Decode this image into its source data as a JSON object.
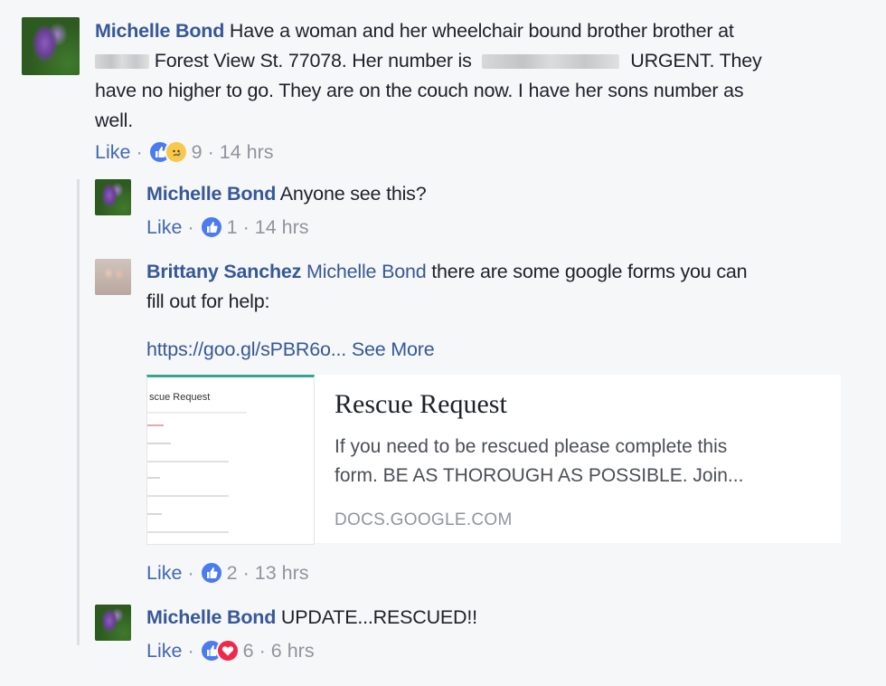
{
  "comments": {
    "main": {
      "author": "Michelle Bond",
      "line1": "Have a woman and her wheelchair bound brother brother at",
      "line2a": "Forest View St. 77078. Her number is",
      "line2b": "URGENT. They",
      "line3": "have no higher to go. They are on the couch now. I have her sons number as",
      "line4": "well.",
      "like_label": "Like",
      "reaction_count": "9",
      "time": "14 hrs"
    },
    "reply1": {
      "author": "Michelle Bond",
      "text": "Anyone see this?",
      "like_label": "Like",
      "reaction_count": "1",
      "time": "14 hrs"
    },
    "reply2": {
      "author": "Brittany Sanchez",
      "mention": "Michelle Bond",
      "line1": "there are some google forms you can",
      "line2": "fill out for help:",
      "link": "https://goo.gl/sPBR6o...",
      "see_more": "See More",
      "like_label": "Like",
      "reaction_count": "2",
      "time": "13 hrs"
    },
    "reply3": {
      "author": "Michelle Bond",
      "text": "UPDATE...RESCUED!!",
      "like_label": "Like",
      "reaction_count": "6",
      "time": "6 hrs"
    }
  },
  "link_preview": {
    "thumb_title": "scue Request",
    "title": "Rescue Request",
    "description_line1": "If you need to be rescued please complete this",
    "description_line2": "form. BE AS THOROUGH AS POSSIBLE. Join...",
    "domain": "DOCS.GOOGLE.COM"
  },
  "separator": "·",
  "icons": {
    "like": "like-reaction-icon",
    "sad": "sad-reaction-icon",
    "love": "love-reaction-icon"
  },
  "colors": {
    "name_link": "#365899",
    "meta_gray": "#90949c",
    "like_blue": "#4a7bf0",
    "love_red": "#f0284a",
    "sad_yellow": "#f7c84a",
    "form_accent": "#34a68f"
  }
}
